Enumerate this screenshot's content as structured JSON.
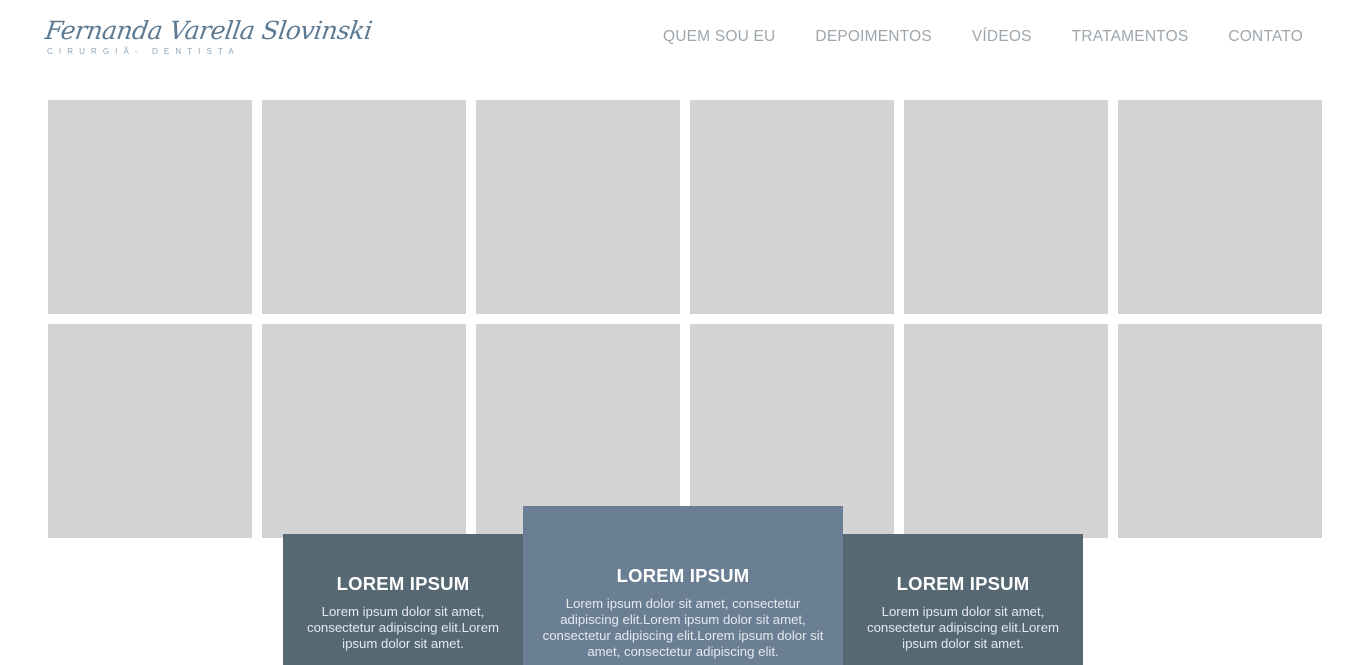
{
  "header": {
    "logo_name": "Fernanda Varella Slovinski",
    "logo_subtitle": "CIRURGIÃ- DENTISTA"
  },
  "nav": {
    "items": [
      {
        "label": "QUEM SOU EU"
      },
      {
        "label": "DEPOIMENTOS"
      },
      {
        "label": "VÍDEOS"
      },
      {
        "label": "TRATAMENTOS"
      },
      {
        "label": "CONTATO"
      }
    ]
  },
  "gallery": {
    "rows": 2,
    "columns": 6,
    "placeholder_color": "#d3d3d3"
  },
  "cards": [
    {
      "title": "LOREM IPSUM",
      "text": "Lorem ipsum dolor sit amet, consectetur adipiscing elit.Lorem ipsum dolor sit amet."
    },
    {
      "title": "LOREM IPSUM",
      "text": "Lorem ipsum dolor sit amet, consectetur adipiscing elit.Lorem ipsum dolor sit amet, consectetur adipiscing elit.Lorem ipsum dolor sit amet, consectetur adipiscing elit."
    },
    {
      "title": "LOREM IPSUM",
      "text": "Lorem ipsum dolor sit amet, consectetur adipiscing elit.Lorem ipsum dolor sit amet."
    }
  ],
  "colors": {
    "brand": "#5d7a93",
    "nav_text": "#9da6ad",
    "card_dark": "#556874",
    "card_accent": "#6a7f93"
  }
}
